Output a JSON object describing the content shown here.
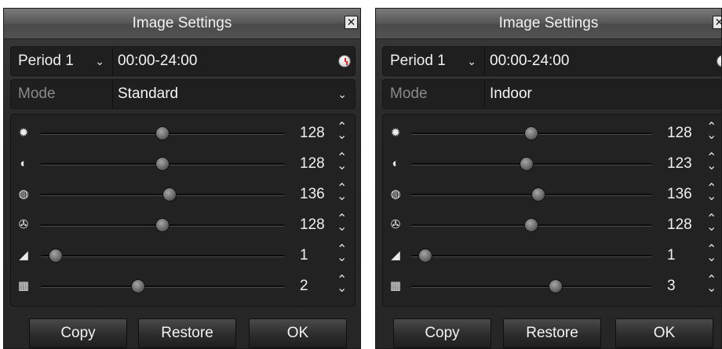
{
  "panels": [
    {
      "title": "Image Settings",
      "period": {
        "label": "Period 1",
        "time_range": "00:00-24:00"
      },
      "mode": {
        "label": "Mode",
        "value": "Standard"
      },
      "sliders": [
        {
          "icon": "brightness-icon",
          "value_text": "128",
          "level": 0.5
        },
        {
          "icon": "contrast-icon",
          "value_text": "128",
          "level": 0.5
        },
        {
          "icon": "saturation-icon",
          "value_text": "136",
          "level": 0.53
        },
        {
          "icon": "hue-icon",
          "value_text": "128",
          "level": 0.5
        },
        {
          "icon": "sharpness-icon",
          "value_text": "1",
          "level": 0.06
        },
        {
          "icon": "denoising-icon",
          "value_text": "2",
          "level": 0.4
        }
      ],
      "buttons": {
        "copy": "Copy",
        "restore": "Restore",
        "ok": "OK"
      }
    },
    {
      "title": "Image Settings",
      "period": {
        "label": "Period 1",
        "time_range": "00:00-24:00"
      },
      "mode": {
        "label": "Mode",
        "value": "Indoor"
      },
      "sliders": [
        {
          "icon": "brightness-icon",
          "value_text": "128",
          "level": 0.5
        },
        {
          "icon": "contrast-icon",
          "value_text": "123",
          "level": 0.48
        },
        {
          "icon": "saturation-icon",
          "value_text": "136",
          "level": 0.53
        },
        {
          "icon": "hue-icon",
          "value_text": "128",
          "level": 0.5
        },
        {
          "icon": "sharpness-icon",
          "value_text": "1",
          "level": 0.06
        },
        {
          "icon": "denoising-icon",
          "value_text": "3",
          "level": 0.6
        }
      ],
      "buttons": {
        "copy": "Copy",
        "restore": "Restore",
        "ok": "OK"
      }
    }
  ]
}
